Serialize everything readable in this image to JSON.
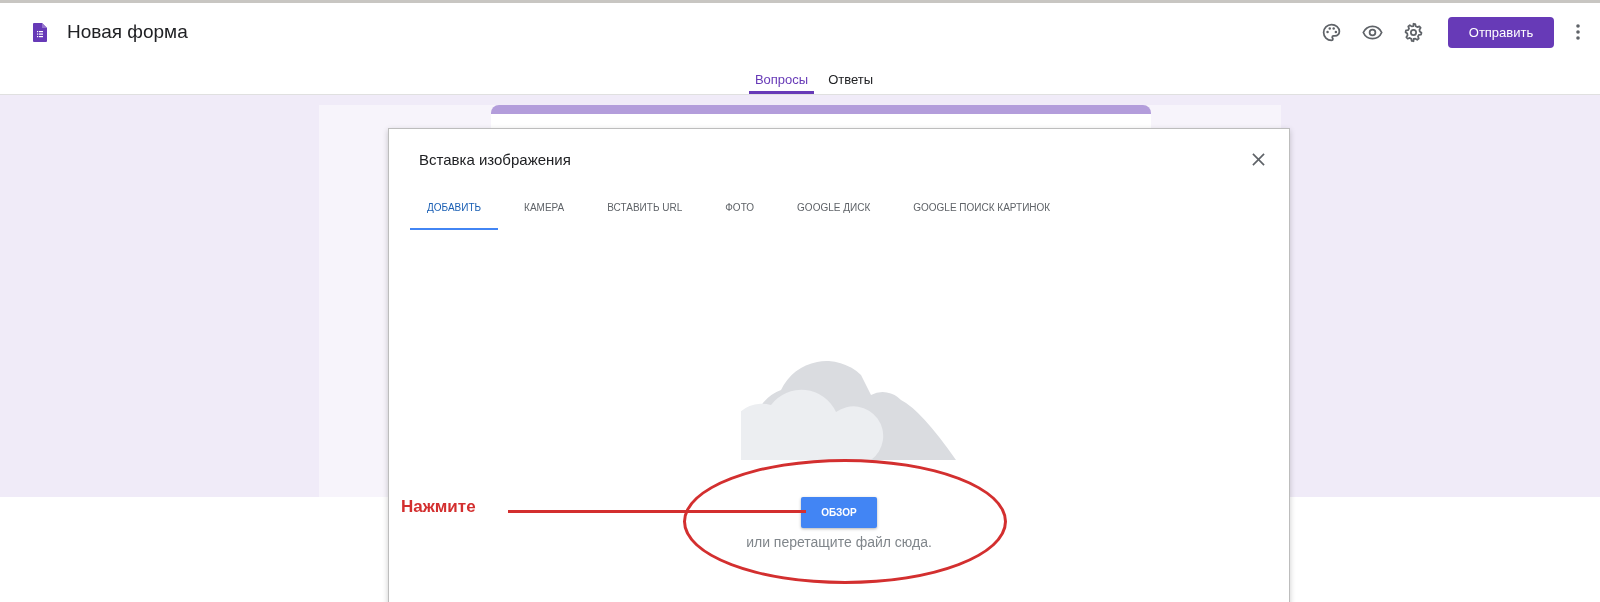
{
  "header": {
    "title": "Новая форма",
    "send_button": "Отправить"
  },
  "form_tabs": [
    {
      "label": "Вопросы",
      "selected": true
    },
    {
      "label": "Ответы",
      "selected": false
    }
  ],
  "dialog": {
    "title": "Вставка изображения",
    "tabs": [
      {
        "label": "ДОБАВИТЬ",
        "selected": true
      },
      {
        "label": "КАМЕРА",
        "selected": false
      },
      {
        "label": "ВСТАВИТЬ URL",
        "selected": false
      },
      {
        "label": "ФОТО",
        "selected": false
      },
      {
        "label": "GOOGLE ДИСК",
        "selected": false
      },
      {
        "label": "GOOGLE ПОИСК КАРТИНОК",
        "selected": false
      }
    ],
    "browse_button": "ОБЗОР",
    "hint": "или перетащите файл сюда."
  },
  "annotation": {
    "label": "Нажмите"
  }
}
